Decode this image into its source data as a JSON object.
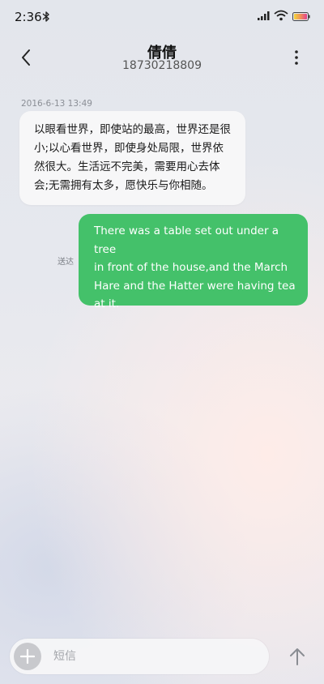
{
  "status_bar": {
    "time": "2:36",
    "icons": [
      "bluetooth-icon",
      "signal-icon",
      "wifi-icon",
      "battery-icon"
    ]
  },
  "header": {
    "contact_name": "倩倩",
    "contact_number": "18730218809",
    "back_icon": "chevron-left-icon",
    "more_icon": "more-vertical-icon"
  },
  "conversation": {
    "timestamp": "2016-6-13 13:49",
    "incoming": {
      "lines": [
        "以眼看世界，即使站的最高，世界还是很",
        "小;以心看世界，即使身处局限，世界依",
        "然很大。生活远不完美，需要用心去体",
        "会;无需拥有太多，愿快乐与你相随。"
      ]
    },
    "outgoing": {
      "lines": [
        "There was a table set out under a tree",
        "in front of the house,and the March",
        "Hare and the Hatter were having tea",
        "at it."
      ],
      "status": "送达"
    }
  },
  "composer": {
    "value": "",
    "placeholder": "短信",
    "add_icon": "plus-icon",
    "send_icon": "arrow-up-icon"
  },
  "colors": {
    "outgoing_bubble": "#44c16a",
    "incoming_bubble": "#f7f7f8",
    "battery_gradient": [
      "#f2d43a",
      "#e2408f"
    ]
  }
}
